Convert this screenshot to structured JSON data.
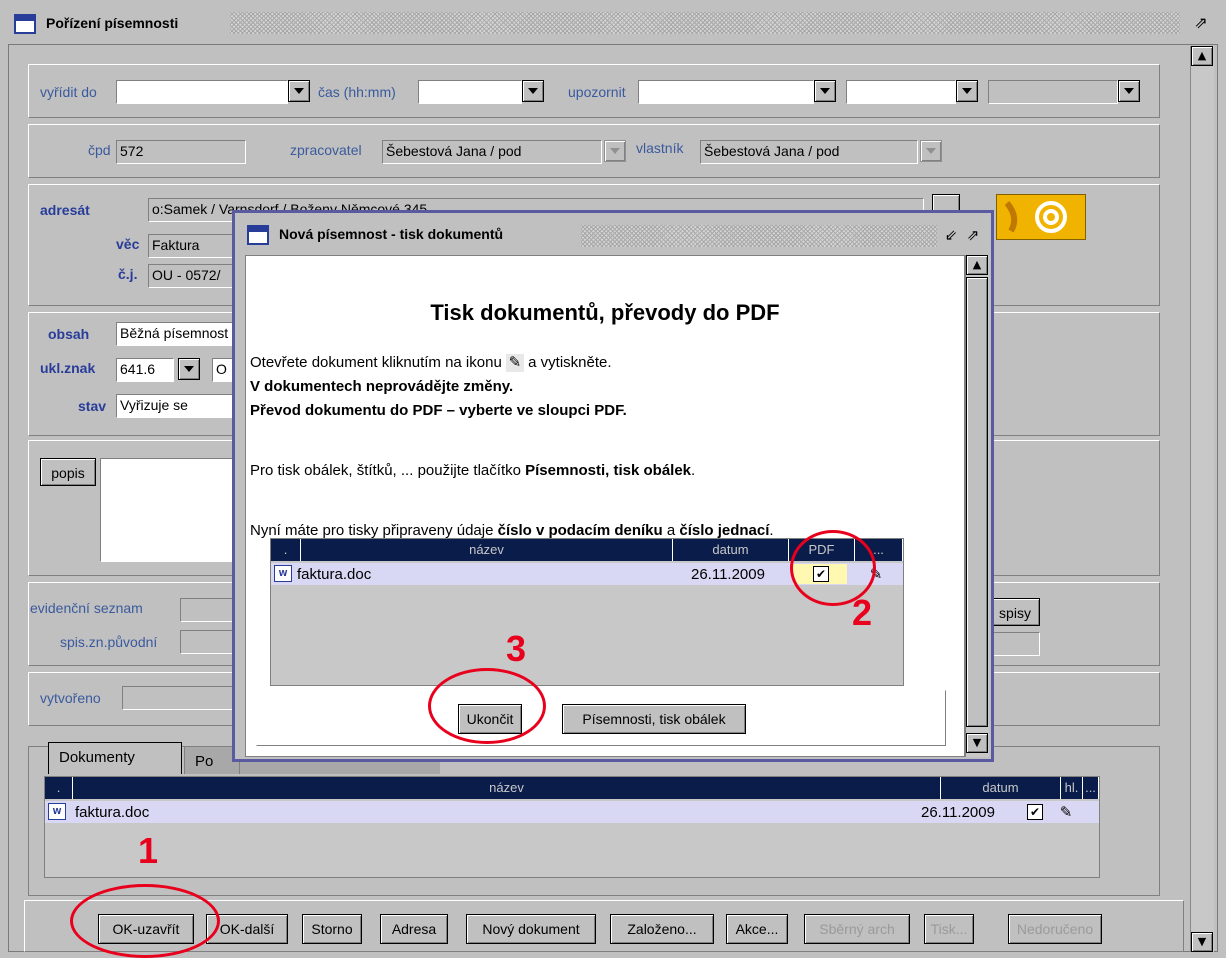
{
  "window": {
    "title": "Pořízení písemnosti"
  },
  "row1": {
    "vyridit_label": "vyřídit do",
    "vyridit_value": "",
    "cas_label": "čas (hh:mm)",
    "cas_value": "",
    "upozornit_label": "upozornit",
    "upozornit_value": "",
    "extra1": "",
    "extra2": ""
  },
  "row2": {
    "cpd_label": "čpd",
    "cpd_value": "572",
    "zpracovatel_label": "zpracovatel",
    "zpracovatel_value": "Šebestová Jana / pod",
    "vlastnik_label": "vlastník",
    "vlastnik_value": "Šebestová Jana / pod"
  },
  "addr": {
    "adresat_label": "adresát",
    "adresat_value": "o:Samek / Varnsdorf / Boženy Němcové 345",
    "vec_label": "věc",
    "vec_value": "Faktura",
    "cj_label": "č.j.",
    "cj_value": "OU - 0572/"
  },
  "content": {
    "obsah_label": "obsah",
    "obsah_value": "Běžná písemnost",
    "ukl_label": "ukl.znak",
    "ukl_value": "641.6",
    "ukl_extra": "O",
    "stav_label": "stav",
    "stav_value": "Vyřizuje se"
  },
  "popis": {
    "button": "popis",
    "text": ""
  },
  "evid": {
    "seznam_label": "evidenční seznam",
    "seznam_value": "",
    "spis_label": "spis.zn.původní",
    "spis_value": "",
    "spisy_button": "spisy"
  },
  "created": {
    "label": "vytvořeno",
    "value": ""
  },
  "tabs": [
    {
      "label": "Dokumenty"
    },
    {
      "label": "Po"
    }
  ],
  "doc_table": {
    "headers": [
      ".",
      "název",
      "datum",
      "hl.",
      "..."
    ],
    "rows": [
      {
        "name": "faktura.doc",
        "date": "26.11.2009",
        "checked": "✔"
      }
    ]
  },
  "bottom_buttons": [
    {
      "label": "OK-uzavřít",
      "enabled": true
    },
    {
      "label": "OK-další",
      "enabled": true
    },
    {
      "label": "Storno",
      "enabled": true
    },
    {
      "label": "Adresa",
      "enabled": true
    },
    {
      "label": "Nový dokument",
      "enabled": true
    },
    {
      "label": "Založeno...",
      "enabled": true
    },
    {
      "label": "Akce...",
      "enabled": true
    },
    {
      "label": "Sběrný arch",
      "enabled": false
    },
    {
      "label": "Tisk...",
      "enabled": false
    },
    {
      "label": "Nedoručeno",
      "enabled": false
    }
  ],
  "dialog": {
    "title": "Nová písemnost - tisk dokumentů",
    "heading": "Tisk dokumentů, převody do PDF",
    "line1a": "Otevřete dokument kliknutím na ikonu",
    "line1b": "a vytiskněte.",
    "line2": "V dokumentech neprovádějte změny.",
    "line3": "Převod dokumentu do PDF – vyberte ve sloupci PDF.",
    "line4a": "Pro tisk obálek, štítků, ... použijte tlačítko",
    "line4b": "Písemnosti, tisk obálek",
    "line4c": ".",
    "line5a": "Nyní máte pro tisky připraveny údaje",
    "line5b": "číslo v podacím deníku",
    "line5c": "a",
    "line5d": "číslo jednací",
    "line5e": ".",
    "table": {
      "headers": [
        ".",
        "název",
        "datum",
        "PDF",
        "..."
      ],
      "rows": [
        {
          "name": "faktura.doc",
          "date": "26.11.2009",
          "pdf": "✔"
        }
      ]
    },
    "btn_close": "Ukončit",
    "btn_print": "Písemnosti, tisk obálek"
  },
  "annotations": {
    "n1": "1",
    "n2": "2",
    "n3": "3",
    "color": "#e8001c"
  },
  "icons": {
    "email": "email-at-icon",
    "doc": "word-doc-icon",
    "edit": "edit-pencil-icon"
  }
}
